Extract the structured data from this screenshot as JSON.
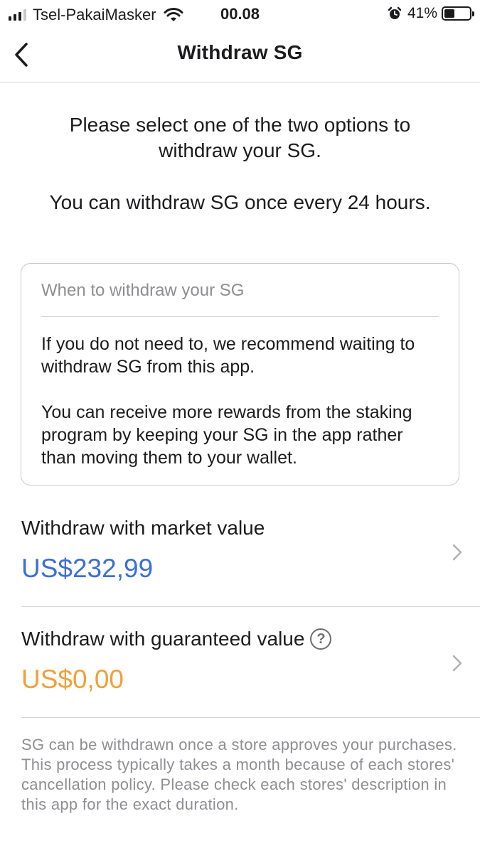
{
  "status_bar": {
    "carrier": "Tsel-PakaiMasker",
    "time": "00.08",
    "battery_percent_text": "41%",
    "battery_level": 0.41
  },
  "nav": {
    "title": "Withdraw SG"
  },
  "intro": {
    "line1": "Please select one of the two options to withdraw your SG.",
    "line2": "You can withdraw SG once every 24 hours."
  },
  "info_card": {
    "title": "When to withdraw your SG",
    "paragraph1": "If you do not need to, we recommend waiting to withdraw SG from this app.",
    "paragraph2": "You can receive more rewards from the staking program by keeping your SG in the app rather than moving them to your wallet."
  },
  "options": [
    {
      "label": "Withdraw with market value",
      "value": "US$232,99",
      "value_color": "#3a6fd8"
    },
    {
      "label": "Withdraw with guaranteed value",
      "value": "US$0,00",
      "value_color": "#f0a03a"
    }
  ],
  "footnote": "SG can be withdrawn once a store approves your purchases. This process typically takes a month because of each stores' cancellation policy. Please check each stores' description in this app for the exact duration."
}
